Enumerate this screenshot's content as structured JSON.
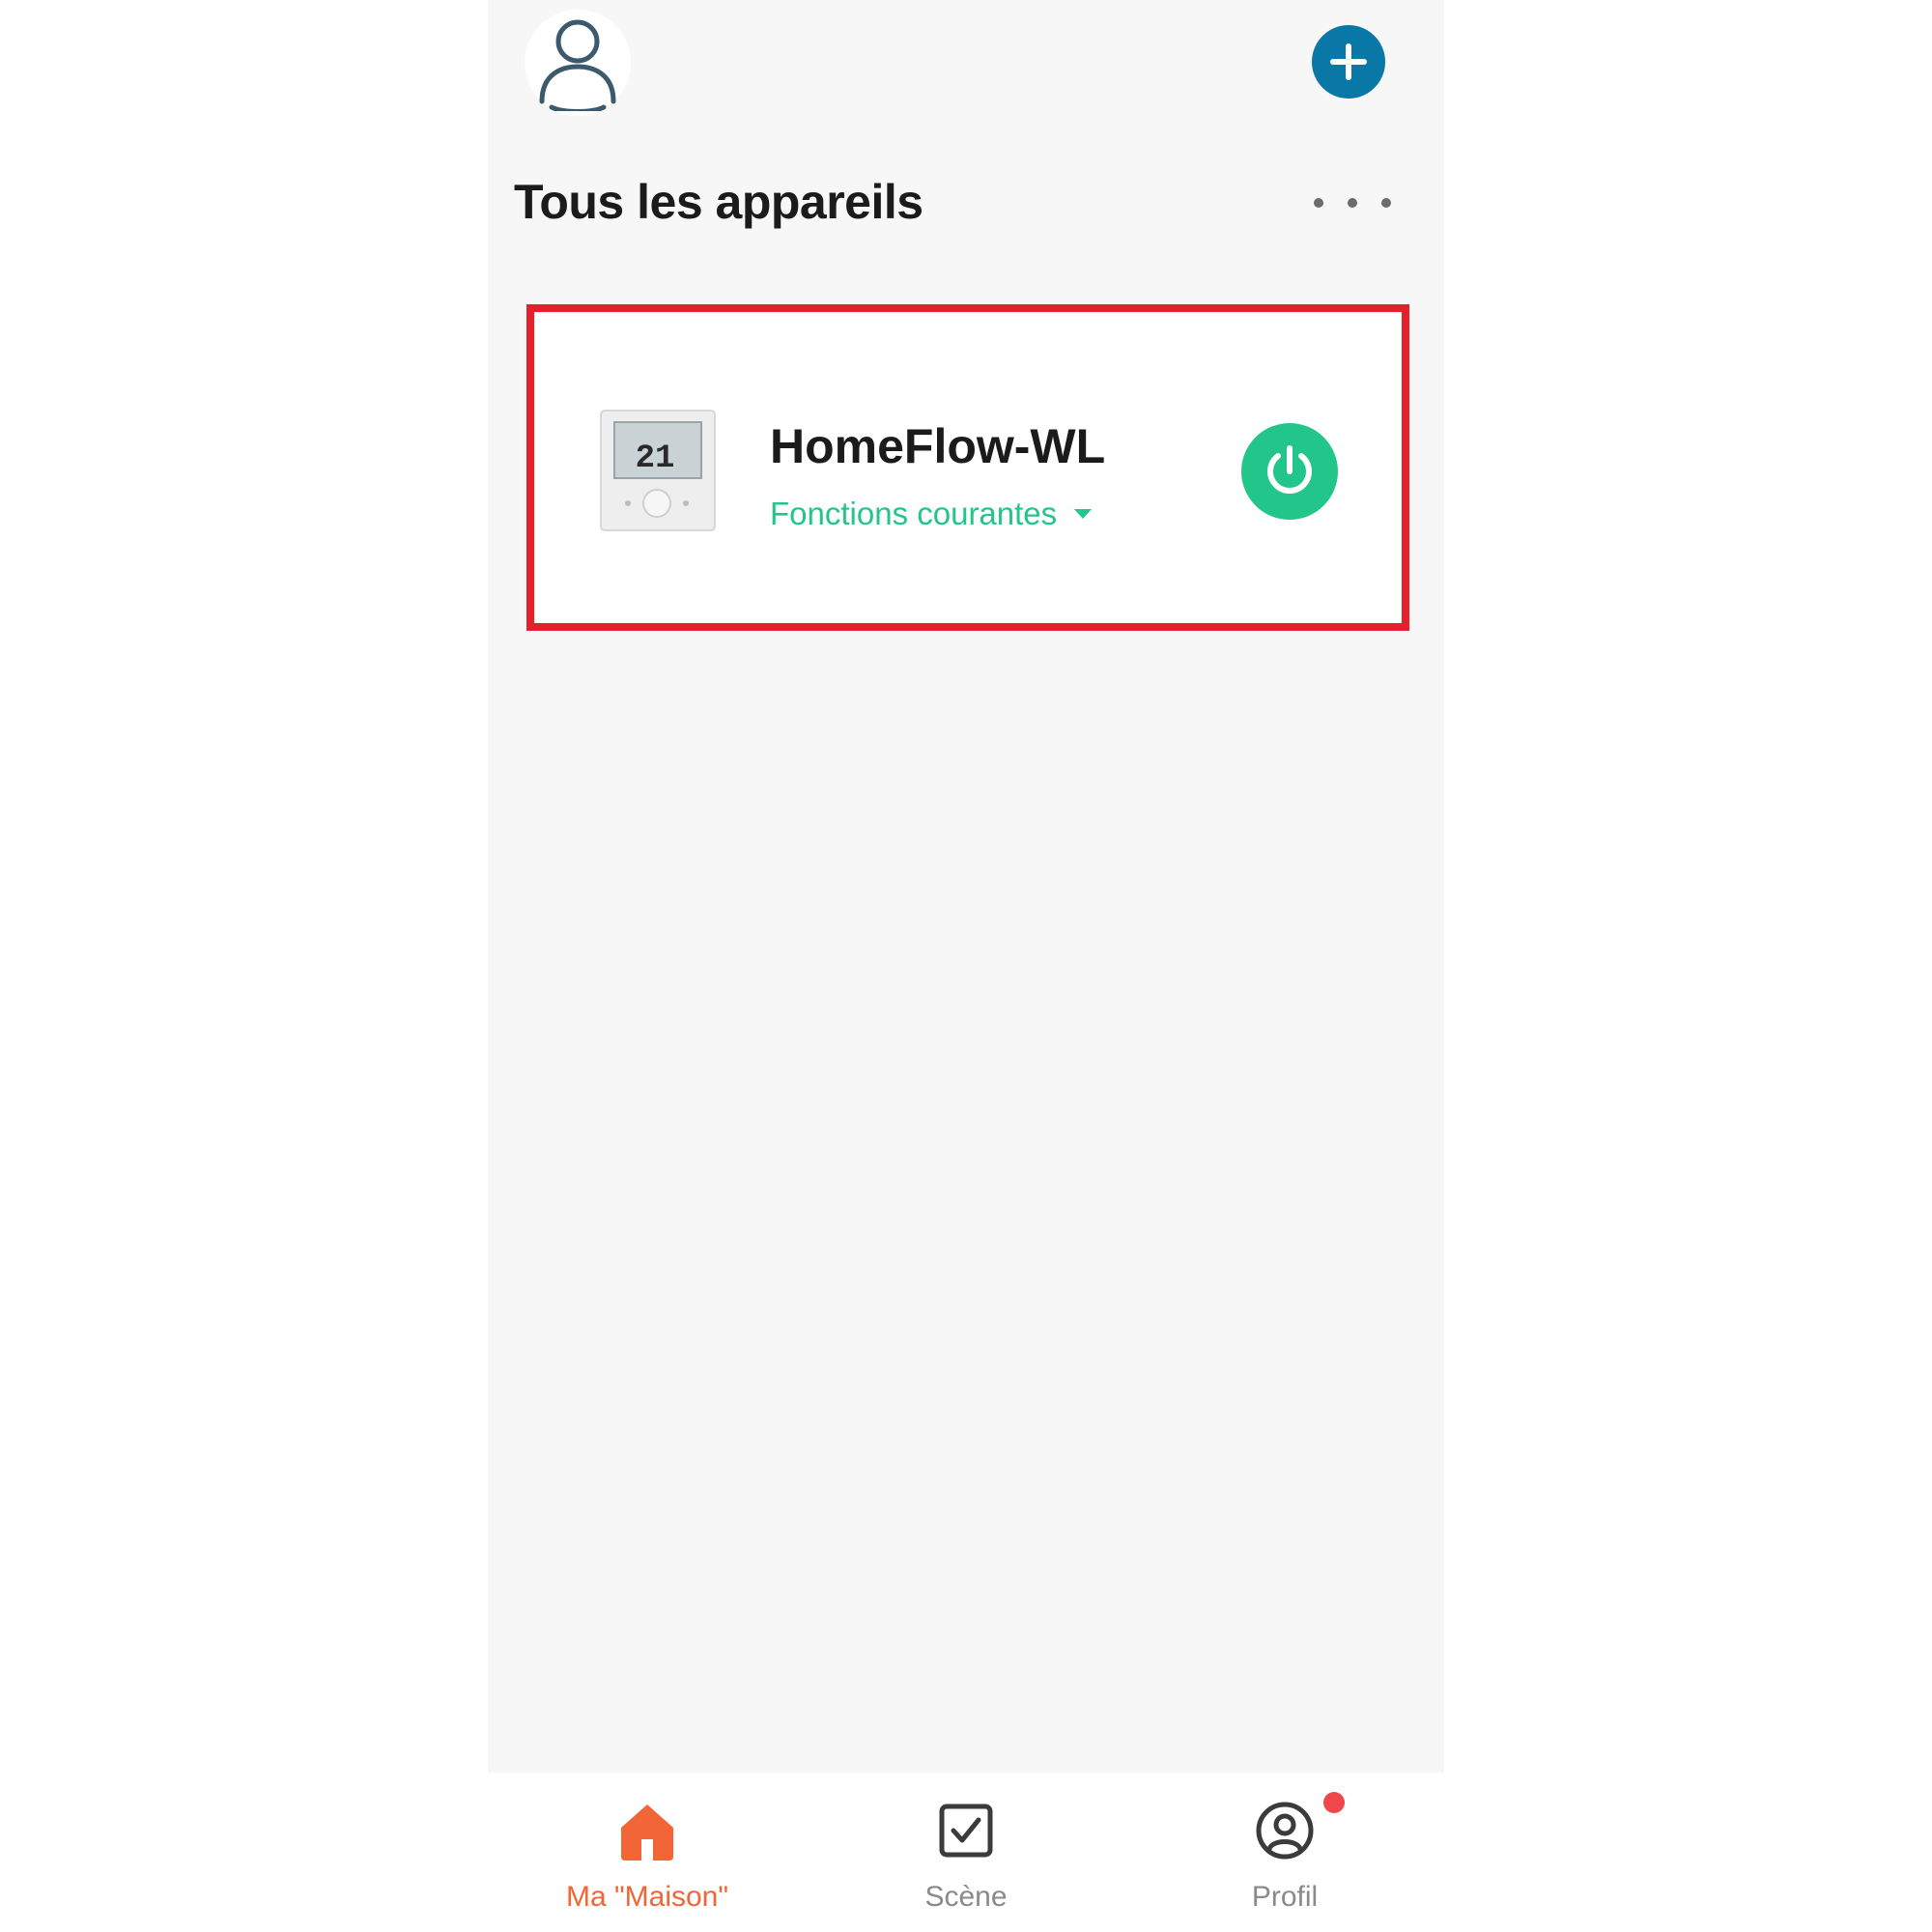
{
  "header": {
    "avatar_icon": "user-icon",
    "add_icon": "plus-icon"
  },
  "section": {
    "title": "Tous les appareils",
    "more_icon": "more-dots-icon"
  },
  "devices": [
    {
      "name": "HomeFlow-WL",
      "functions_label": "Fonctions courantes",
      "thumbnail_icon": "thermostat-icon",
      "thumbnail_reading": "21",
      "power_icon": "power-icon",
      "power_color": "#22c58a",
      "highlight_color": "#e3202b"
    }
  ],
  "tabbar": {
    "tabs": [
      {
        "label": "Ma \"Maison\"",
        "icon": "home-icon",
        "active": true
      },
      {
        "label": "Scène",
        "icon": "checkbox-icon",
        "active": false
      },
      {
        "label": "Profil",
        "icon": "profile-icon",
        "active": false,
        "badge": true
      }
    ]
  },
  "colors": {
    "accent_blue": "#0a78a6",
    "accent_green": "#22c58a",
    "active_tab": "#f26537",
    "badge": "#f0474a"
  }
}
